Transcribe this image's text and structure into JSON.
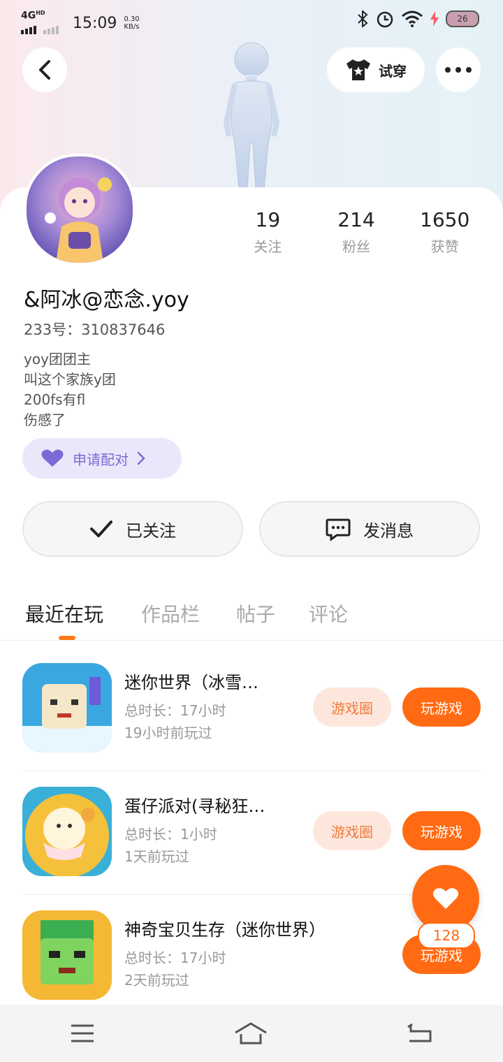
{
  "status_bar": {
    "network": "4G",
    "network_sup": "HD",
    "time": "15:09",
    "speed_value": "0.30",
    "speed_unit": "KB/s",
    "battery": "26"
  },
  "header": {
    "back_icon": "back-arrow-icon",
    "try_on_label": "试穿",
    "more_icon": "more-dots-icon"
  },
  "profile": {
    "name": "&阿冰@恋念.yoy",
    "id_line": "233号：310837646",
    "bio": [
      "yoy团团主",
      "叫这个家族y团",
      "200fs有fl",
      "伤感了"
    ],
    "pair_label": "申请配对",
    "stats": [
      {
        "value": "19",
        "label": "关注"
      },
      {
        "value": "214",
        "label": "粉丝"
      },
      {
        "value": "1650",
        "label": "获赞"
      }
    ],
    "follow_label": "已关注",
    "message_label": "发消息"
  },
  "tabs": [
    {
      "label": "最近在玩",
      "active": true
    },
    {
      "label": "作品栏",
      "active": false
    },
    {
      "label": "帖子",
      "active": false
    },
    {
      "label": "评论",
      "active": false
    }
  ],
  "games": [
    {
      "title": "迷你世界（冰雪…",
      "duration": "总时长：17小时",
      "last_played": "19小时前玩过",
      "circle_label": "游戏圈",
      "play_label": "玩游戏"
    },
    {
      "title": "蛋仔派对(寻秘狂…",
      "duration": "总时长：1小时",
      "last_played": "1天前玩过",
      "circle_label": "游戏圈",
      "play_label": "玩游戏"
    },
    {
      "title": "神奇宝贝生存（迷你世界）",
      "duration": "总时长：17小时",
      "last_played": "2天前玩过",
      "circle_label": "",
      "play_label": "玩游戏"
    }
  ],
  "like_fab": {
    "count": "128"
  },
  "colors": {
    "accent": "#ff6a13",
    "pair_purple": "#7b6bd6",
    "circle_bg": "#fde7dc"
  }
}
